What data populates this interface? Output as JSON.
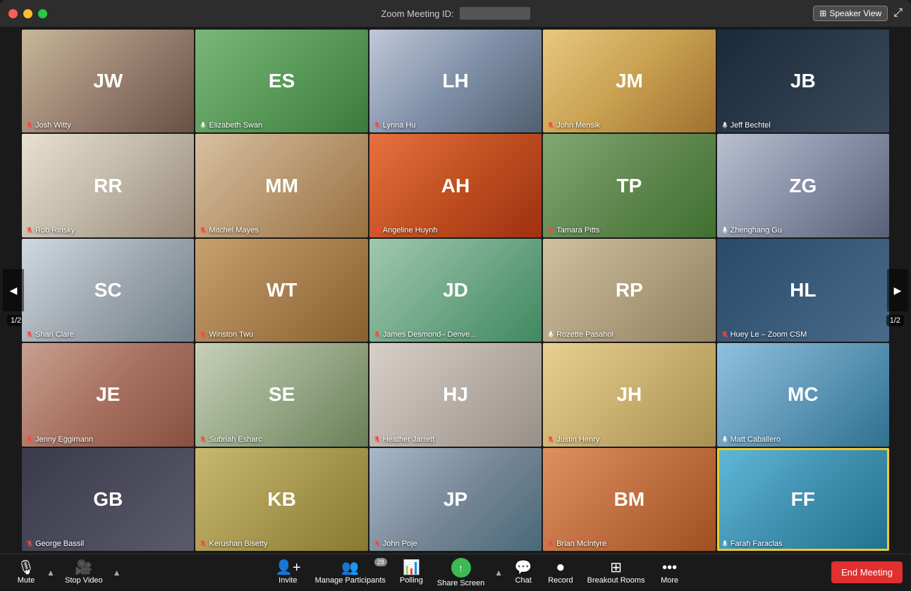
{
  "titlebar": {
    "meeting_id_label": "Zoom Meeting ID:",
    "speaker_view_label": "Speaker View"
  },
  "nav": {
    "left_arrow": "◀",
    "right_arrow": "▶",
    "page_left": "1/2",
    "page_right": "1/2"
  },
  "participants": [
    {
      "name": "Josh Witty",
      "muted": true,
      "bg": "bg-1"
    },
    {
      "name": "Elizabeth Swan",
      "muted": false,
      "bg": "bg-2"
    },
    {
      "name": "Lynna Hu",
      "muted": true,
      "bg": "bg-3"
    },
    {
      "name": "John Mensik",
      "muted": true,
      "bg": "bg-4"
    },
    {
      "name": "Jeff Bechtel",
      "muted": false,
      "bg": "bg-5"
    },
    {
      "name": "Rob Rinsky",
      "muted": true,
      "bg": "bg-6"
    },
    {
      "name": "Mitchel Mayes",
      "muted": true,
      "bg": "bg-7"
    },
    {
      "name": "Angeline Huynh",
      "muted": true,
      "bg": "bg-8"
    },
    {
      "name": "Tamara Pitts",
      "muted": true,
      "bg": "bg-9"
    },
    {
      "name": "Zhenghang Gu",
      "muted": false,
      "bg": "bg-10"
    },
    {
      "name": "Shari Clare",
      "muted": true,
      "bg": "bg-11"
    },
    {
      "name": "Winston Twu",
      "muted": true,
      "bg": "bg-12"
    },
    {
      "name": "James Desmond– Denve...",
      "muted": true,
      "bg": "bg-13"
    },
    {
      "name": "Rozette Pasahol",
      "muted": false,
      "bg": "bg-14"
    },
    {
      "name": "Huey Le – Zoom CSM",
      "muted": true,
      "bg": "bg-15"
    },
    {
      "name": "Jenny Eggimann",
      "muted": true,
      "bg": "bg-16"
    },
    {
      "name": "Subriah Esharc",
      "muted": true,
      "bg": "bg-17"
    },
    {
      "name": "Heather Jarrett",
      "muted": true,
      "bg": "bg-18"
    },
    {
      "name": "Justin Henry",
      "muted": true,
      "bg": "bg-19"
    },
    {
      "name": "Matt Caballero",
      "muted": false,
      "bg": "bg-20"
    },
    {
      "name": "George Bassil",
      "muted": true,
      "bg": "bg-21"
    },
    {
      "name": "Kerushan Bisetty",
      "muted": true,
      "bg": "bg-22"
    },
    {
      "name": "John Poje",
      "muted": true,
      "bg": "bg-23"
    },
    {
      "name": "Brian McIntyre",
      "muted": true,
      "bg": "bg-24"
    },
    {
      "name": "Farah Faraclas",
      "muted": false,
      "bg": "bg-25",
      "active": true
    }
  ],
  "toolbar": {
    "mute_label": "Mute",
    "stop_video_label": "Stop Video",
    "invite_label": "Invite",
    "manage_participants_label": "Manage Participants",
    "participants_count": "28",
    "polling_label": "Polling",
    "share_screen_label": "Share Screen",
    "chat_label": "Chat",
    "record_label": "Record",
    "breakout_rooms_label": "Breakout Rooms",
    "more_label": "More",
    "end_meeting_label": "End Meeting"
  }
}
